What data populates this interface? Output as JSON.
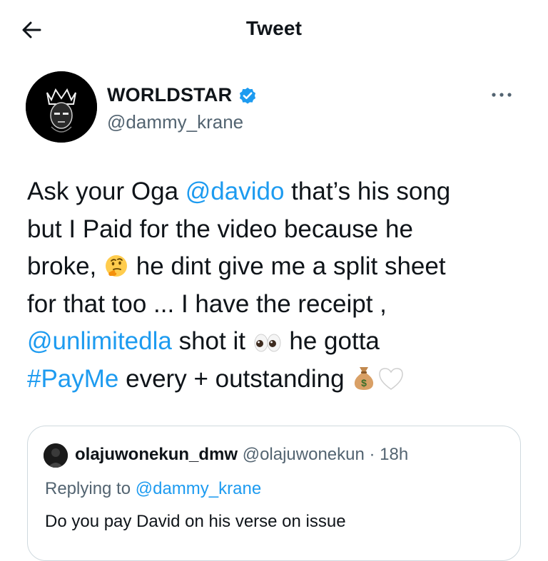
{
  "header": {
    "title": "Tweet",
    "back_icon": "arrow-left-icon"
  },
  "author": {
    "display_name": "WORLDSTAR",
    "handle": "@dammy_krane",
    "verified": true,
    "verified_color": "#1d9bf0"
  },
  "tweet": {
    "line1": {
      "pre": "Ask your Oga ",
      "mention": "@davido",
      "post": " that’s his song"
    },
    "line2": "but I Paid for the video because he",
    "line3": {
      "pre": "broke, ",
      "emoji": "thinking-face",
      "post": " he dint give me a split sheet"
    },
    "line4": "for that too  ... I have the receipt ,",
    "line5": {
      "mention": "@unlimitedla",
      "mid": " shot it ",
      "emoji": "eyes",
      "post": " he gotta"
    },
    "line6": {
      "hashtag": "#PayMe",
      "post": " every + outstanding ",
      "emoji1": "money-bag",
      "emoji2": "white-heart"
    }
  },
  "quoted": {
    "name": "olajuwonekun_dmw",
    "meta": " @olajuwonekun · 18h",
    "reply_prefix": "Replying to ",
    "reply_handle": "@dammy_krane",
    "text": "Do you pay David on his verse on issue"
  },
  "colors": {
    "accent": "#1d9bf0",
    "text": "#0f1419",
    "secondary": "#536471",
    "border": "#cfd9de"
  }
}
